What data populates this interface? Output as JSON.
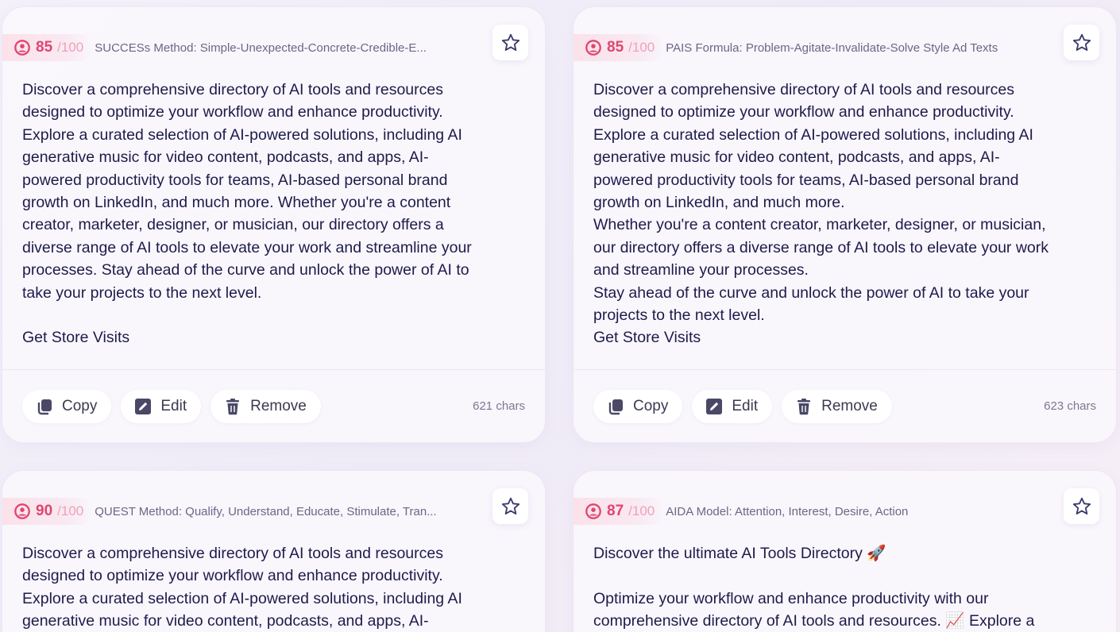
{
  "cards": [
    {
      "score": "85",
      "score_max": "/100",
      "method": "SUCCESs Method: Simple-Unexpected-Concrete-Credible-E...",
      "body": "Discover a comprehensive directory of AI tools and resources\ndesigned to optimize your workflow and enhance productivity.\nExplore a curated selection of AI-powered solutions, including AI\ngenerative music for video content, podcasts, and apps, AI-\npowered productivity tools for teams, AI-based personal brand\ngrowth on LinkedIn, and much more. Whether you're a content\ncreator, marketer, designer, or musician, our directory offers a\ndiverse range of AI tools to elevate your work and streamline your\nprocesses. Stay ahead of the curve and unlock the power of AI to\ntake your projects to the next level.\n\nGet Store Visits",
      "copy_label": "Copy",
      "edit_label": "Edit",
      "remove_label": "Remove",
      "chars": "621 chars"
    },
    {
      "score": "85",
      "score_max": "/100",
      "method": "PAIS Formula: Problem-Agitate-Invalidate-Solve Style Ad Texts",
      "body": "Discover a comprehensive directory of AI tools and resources\ndesigned to optimize your workflow and enhance productivity.\nExplore a curated selection of AI-powered solutions, including AI\ngenerative music for video content, podcasts, and apps, AI-\npowered productivity tools for teams, AI-based personal brand\ngrowth on LinkedIn, and much more.\nWhether you're a content creator, marketer, designer, or musician,\nour directory offers a diverse range of AI tools to elevate your work\nand streamline your processes.\nStay ahead of the curve and unlock the power of AI to take your\nprojects to the next level.\nGet Store Visits",
      "copy_label": "Copy",
      "edit_label": "Edit",
      "remove_label": "Remove",
      "chars": "623 chars"
    },
    {
      "score": "90",
      "score_max": "/100",
      "method": "QUEST Method: Qualify, Understand, Educate, Stimulate, Tran...",
      "body": "Discover a comprehensive directory of AI tools and resources\ndesigned to optimize your workflow and enhance productivity.\nExplore a curated selection of AI-powered solutions, including AI\ngenerative music for video content, podcasts, and apps, AI-"
    },
    {
      "score": "87",
      "score_max": "/100",
      "method": "AIDA Model: Attention, Interest, Desire, Action",
      "body": "Discover the ultimate AI Tools Directory 🚀\n\nOptimize your workflow and enhance productivity with our\ncomprehensive directory of AI tools and resources. 📈 Explore a"
    }
  ],
  "colors": {
    "score": "#e0456e",
    "text": "#1e1b4b",
    "muted": "#6b6785"
  },
  "icons": [
    "score-gauge-icon",
    "star-icon",
    "copy-icon",
    "edit-icon",
    "trash-icon"
  ]
}
